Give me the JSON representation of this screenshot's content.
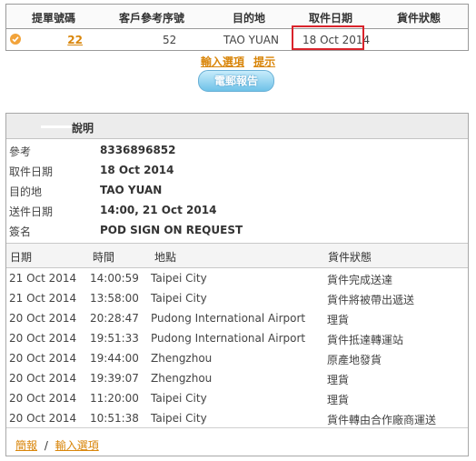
{
  "summary": {
    "headers": [
      "提單號碼",
      "客戶參考序號",
      "目的地",
      "取件日期",
      "貨件狀態"
    ],
    "row": {
      "tracking": "22",
      "reference": "52",
      "destination": "TAO YUAN",
      "pickup_date": "18 Oct 2014",
      "status": ""
    }
  },
  "links": {
    "input_options": "輸入選項",
    "tips": "提示"
  },
  "email_button": "電郵報告",
  "detail": {
    "title": "說明",
    "info": [
      {
        "label": "參考",
        "value": "8336896852"
      },
      {
        "label": "取件日期",
        "value": "18 Oct 2014"
      },
      {
        "label": "目的地",
        "value": "TAO YUAN"
      },
      {
        "label": "送件日期",
        "value": "14:00, 21 Oct 2014"
      },
      {
        "label": "簽名",
        "value": "POD SIGN ON REQUEST"
      }
    ],
    "event_headers": [
      "日期",
      "時間",
      "地點",
      "貨件狀態"
    ],
    "events": [
      {
        "date": "21 Oct 2014",
        "time": "14:00:59",
        "location": "Taipei City",
        "status": "貨件完成送達"
      },
      {
        "date": "21 Oct 2014",
        "time": "13:58:00",
        "location": "Taipei City",
        "status": "貨件將被帶出遞送"
      },
      {
        "date": "20 Oct 2014",
        "time": "20:28:47",
        "location": "Pudong International Airport",
        "status": "理貨"
      },
      {
        "date": "20 Oct 2014",
        "time": "19:51:33",
        "location": "Pudong International Airport",
        "status": "貨件抵達轉運站"
      },
      {
        "date": "20 Oct 2014",
        "time": "19:44:00",
        "location": "Zhengzhou",
        "status": "原產地發貨"
      },
      {
        "date": "20 Oct 2014",
        "time": "19:39:07",
        "location": "Zhengzhou",
        "status": "理貨"
      },
      {
        "date": "20 Oct 2014",
        "time": "11:20:00",
        "location": "Taipei City",
        "status": "理貨"
      },
      {
        "date": "20 Oct 2014",
        "time": "10:51:38",
        "location": "Taipei City",
        "status": "貨件轉由合作廠商運送"
      }
    ],
    "footer": {
      "summary_link": "簡報",
      "separator": "/",
      "input_link": "輸入選項"
    }
  },
  "colors": {
    "link": "#d9860b",
    "highlight": "#d9232b",
    "button": "#6fc2e8"
  },
  "icons": {
    "status": "check-circle-icon"
  }
}
